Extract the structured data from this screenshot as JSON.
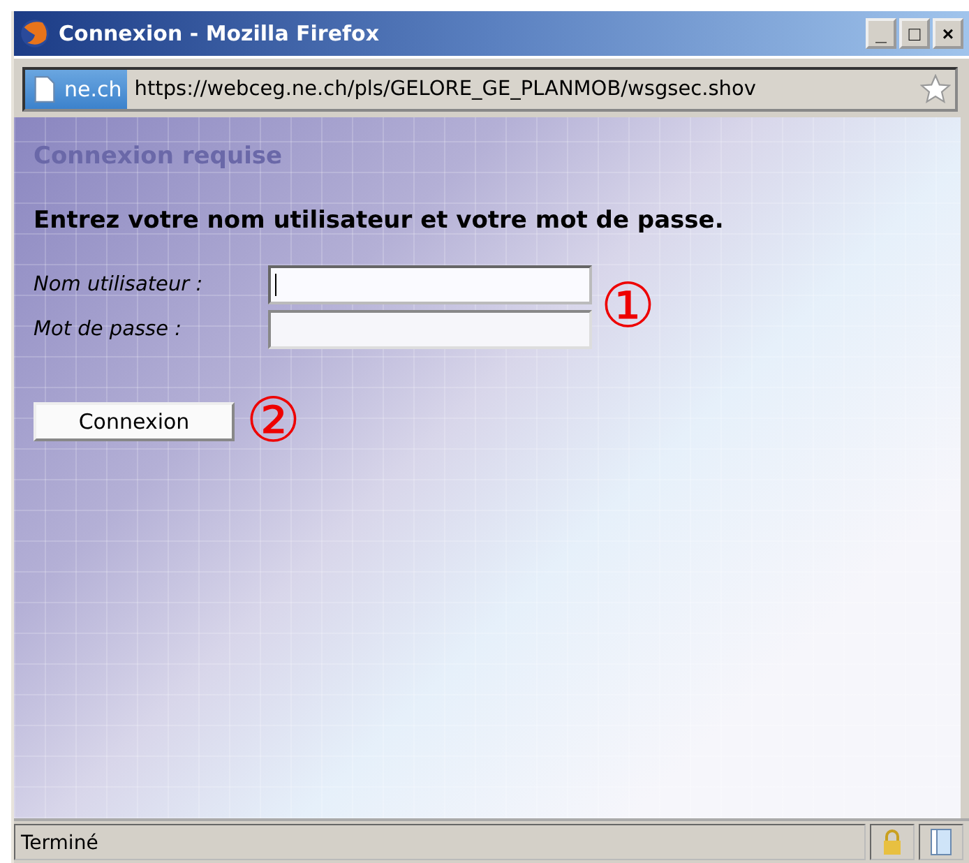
{
  "window": {
    "title": "Connexion - Mozilla Firefox",
    "controls": [
      "_",
      "□",
      "×"
    ]
  },
  "url_bar": {
    "site": "ne.ch",
    "url": "https://webceg.ne.ch/pls/GELORE_GE_PLANMOB/wsgsec.shov"
  },
  "page": {
    "heading": "Connexion requise",
    "instruction": "Entrez votre nom utilisateur et votre mot de passe.",
    "fields": [
      {
        "label": "Nom utilisateur :",
        "focused": true
      },
      {
        "label": "Mot de passe :",
        "focused": false
      }
    ],
    "fields_marker": "①",
    "button": "Connexion",
    "button_marker": "②"
  },
  "status_bar": {
    "text": "Terminé"
  }
}
